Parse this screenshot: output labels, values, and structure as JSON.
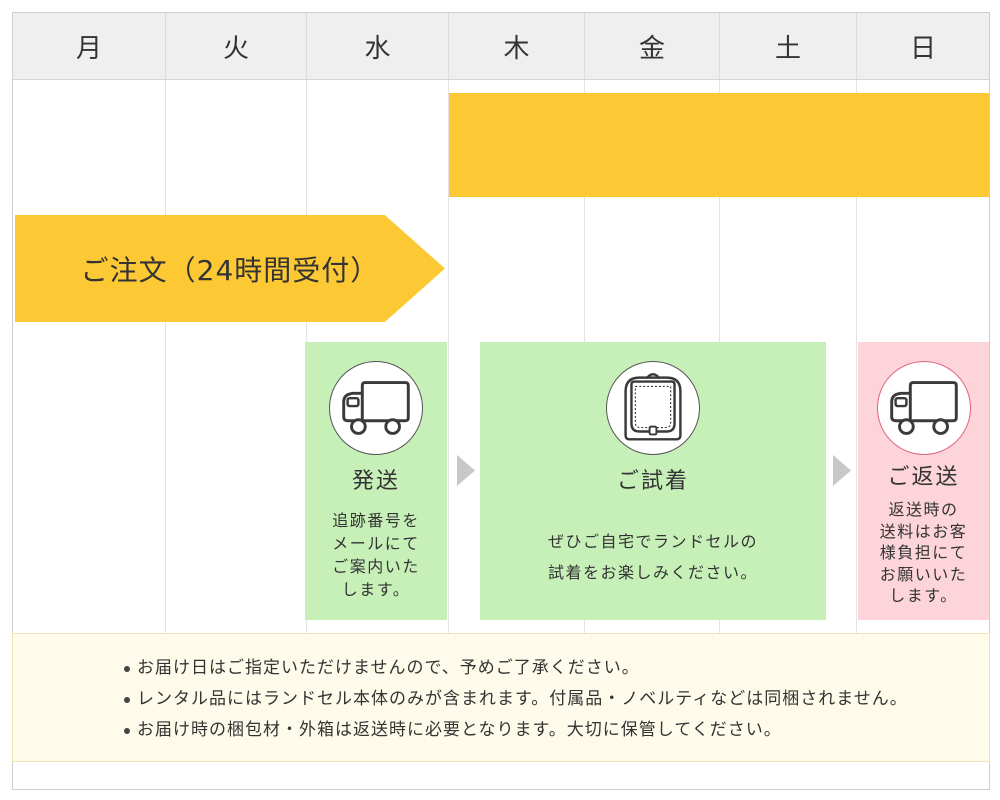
{
  "header": {
    "days": [
      "月",
      "火",
      "水",
      "木",
      "金",
      "土",
      "日"
    ]
  },
  "order": {
    "label": "ご注文（24時間受付）"
  },
  "steps": [
    {
      "icon": "truck-icon",
      "title": "発送",
      "description_lines": [
        "追跡番号を",
        "メールにて",
        "ご案内いた",
        "します。"
      ]
    },
    {
      "icon": "randoseru-icon",
      "title": "ご試着",
      "description_lines": [
        "ぜひご自宅でランドセルの",
        "試着をお楽しみください。"
      ]
    },
    {
      "icon": "truck-icon",
      "title": "ご返送",
      "description_lines": [
        "返送時の",
        "送料はお客",
        "様負担にて",
        "お願いいた",
        "します。"
      ]
    }
  ],
  "step_arrow_icon": "triangle-right-icon",
  "notes": [
    "お届け日はご指定いただけませんので、予めご了承ください。",
    "レンタル品にはランドセル本体のみが含まれます。付属品・ノベルティなどは同梱されません。",
    "お届け時の梱包材・外箱は返送時に必要となります。大切に保管してください。"
  ],
  "colors": {
    "header_background": "#efefef",
    "schedule_band": "#fcc934",
    "order_arrow": "#fcc934",
    "step_green": "#c7f0b8",
    "step_pink": "#fdd4da",
    "next_arrow": "#c8c8c8",
    "note_background": "#fffbeb",
    "note_border": "#f3e4b6"
  }
}
